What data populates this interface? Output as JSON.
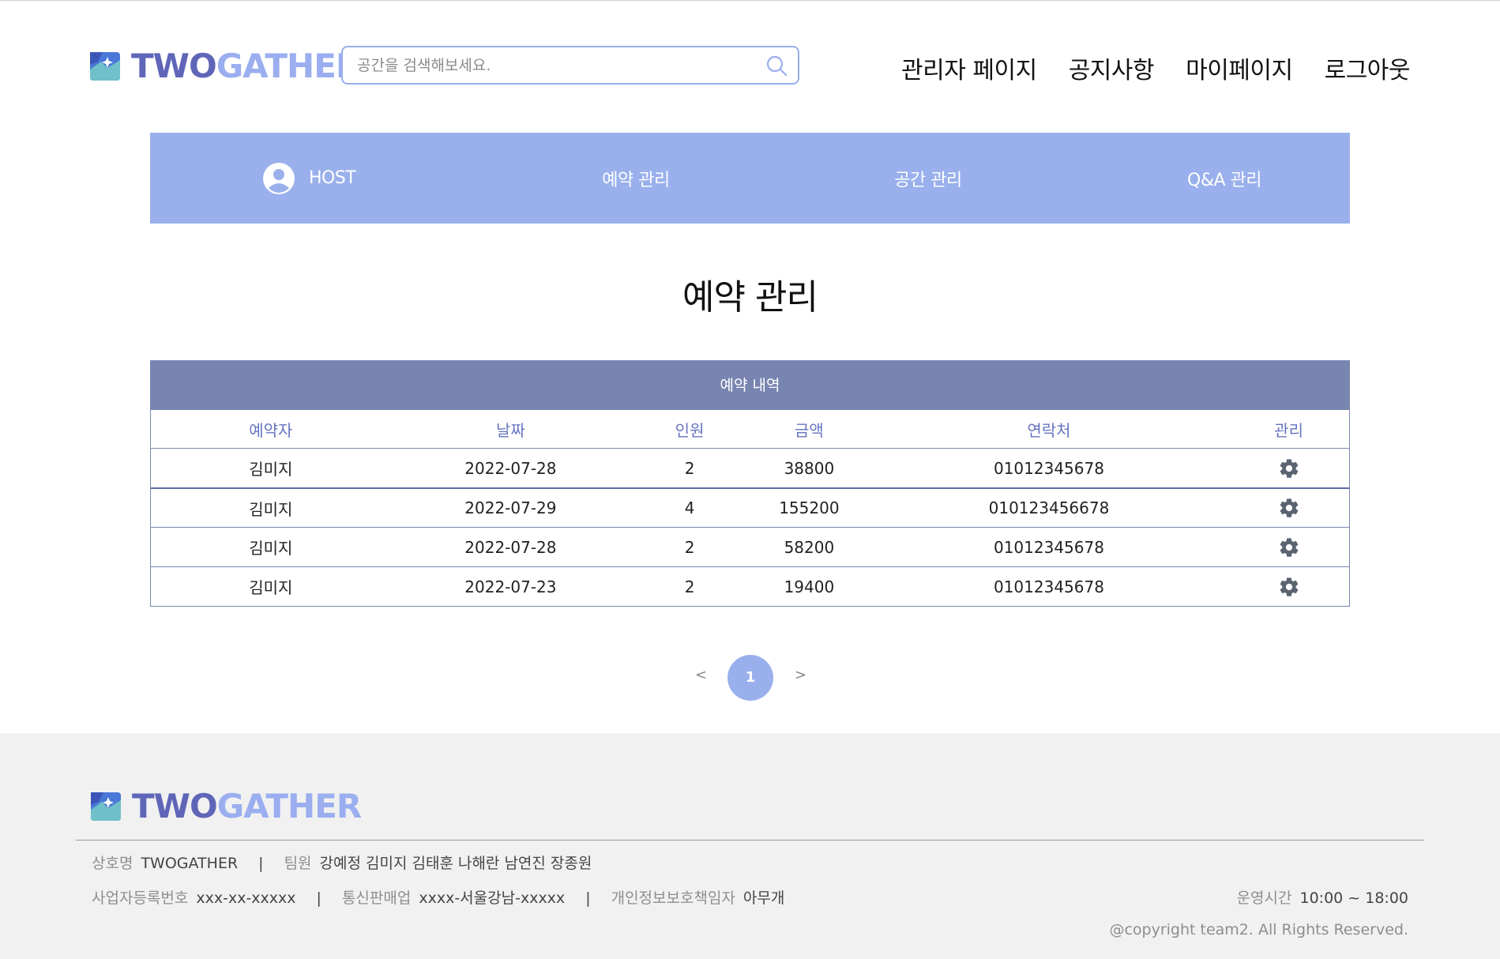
{
  "brand": {
    "part1": "TWO",
    "part2": "GATHER"
  },
  "search": {
    "placeholder": "공간을 검색해보세요."
  },
  "topnav": [
    "관리자 페이지",
    "공지사항",
    "마이페이지",
    "로그아웃"
  ],
  "hostbar": {
    "host_label": "HOST",
    "items": [
      "예약 관리",
      "공간 관리",
      "Q&A 관리"
    ]
  },
  "page_title": "예약 관리",
  "table": {
    "caption": "예약 내역",
    "headers": [
      "예약자",
      "날짜",
      "인원",
      "금액",
      "연락처",
      "관리"
    ],
    "rows": [
      [
        "김미지",
        "2022-07-28",
        "2",
        "38800",
        "01012345678"
      ],
      [
        "김미지",
        "2022-07-29",
        "4",
        "155200",
        "010123456678"
      ],
      [
        "김미지",
        "2022-07-28",
        "2",
        "58200",
        "01012345678"
      ],
      [
        "김미지",
        "2022-07-23",
        "2",
        "19400",
        "01012345678"
      ]
    ]
  },
  "pagination": {
    "prev": "<",
    "current": "1",
    "next": ">"
  },
  "footer": {
    "company_key": "상호명",
    "company_val": "TWOGATHER",
    "team_key": "팀원",
    "team_val": "강예정 김미지 김태훈 나해란 남연진 장종원",
    "biz_key": "사업자등록번호",
    "biz_val": "xxx-xx-xxxxx",
    "mail_key": "통신판매업",
    "mail_val": "xxxx-서울강남-xxxxx",
    "privacy_key": "개인정보보호책임자",
    "privacy_val": "아무개",
    "hours_key": "운영시간",
    "hours_val": "10:00 ~ 18:00",
    "separator": "|",
    "copyright": "@copyright team2. All Rights Reserved."
  },
  "colors": {
    "accent": "#99b0ec",
    "table_header": "#7885b1",
    "brand_dark": "#5f66b8",
    "brand_light": "#9aaef0"
  },
  "icons": {
    "search": "search-icon",
    "avatar": "user-avatar-icon",
    "gear": "gear-icon",
    "logo": "logo-icon"
  }
}
